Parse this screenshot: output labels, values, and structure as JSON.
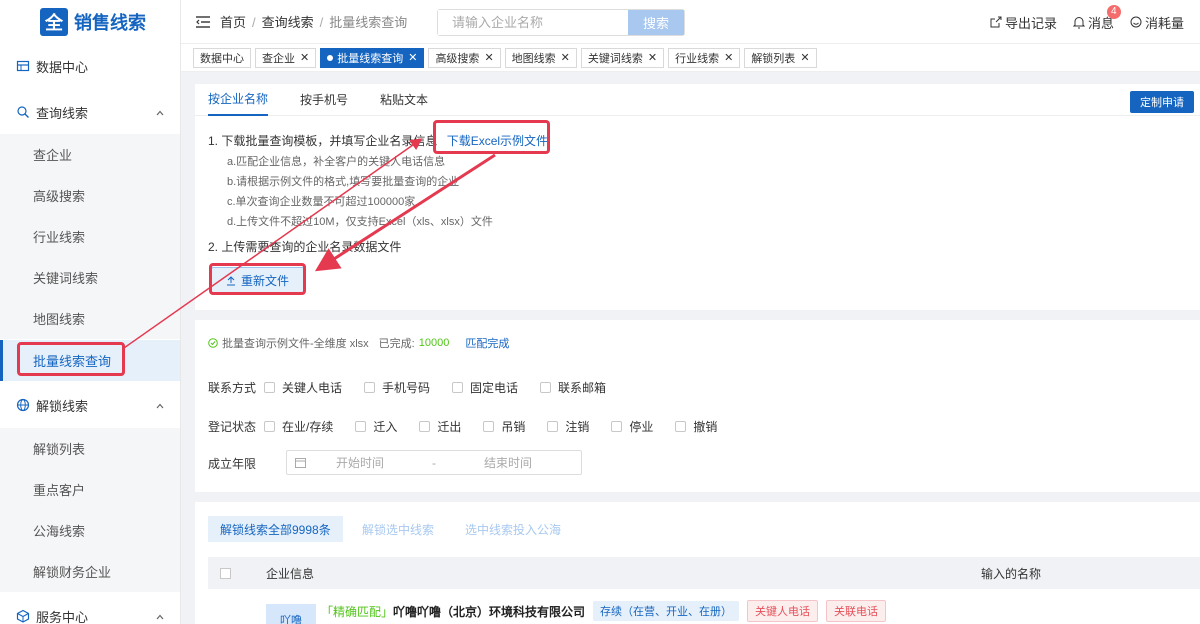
{
  "app": {
    "logo_char": "全",
    "name": "销售线索"
  },
  "sidebar": {
    "data_center": "数据中心",
    "query": "查询线索",
    "query_items": [
      "查企业",
      "高级搜索",
      "行业线索",
      "关键词线索",
      "地图线索",
      "批量线索查询"
    ],
    "unlock": "解锁线索",
    "unlock_items": [
      "解锁列表",
      "重点客户",
      "公海线索",
      "解锁财务企业"
    ],
    "service": "服务中心"
  },
  "header": {
    "breadcrumb": [
      "首页",
      "查询线索",
      "批量线索查询"
    ],
    "search_placeholder": "请输入企业名称",
    "search_button": "搜索",
    "export": "导出记录",
    "messages": "消息",
    "message_count": "4",
    "consumption": "消耗量"
  },
  "tabs": [
    {
      "label": "数据中心",
      "closable": false,
      "active": false
    },
    {
      "label": "查企业",
      "closable": true,
      "active": false
    },
    {
      "label": "批量线索查询",
      "closable": true,
      "active": true
    },
    {
      "label": "高级搜索",
      "closable": true,
      "active": false
    },
    {
      "label": "地图线索",
      "closable": true,
      "active": false
    },
    {
      "label": "关键词线索",
      "closable": true,
      "active": false
    },
    {
      "label": "行业线索",
      "closable": true,
      "active": false
    },
    {
      "label": "解锁列表",
      "closable": true,
      "active": false
    }
  ],
  "panel": {
    "tabs": [
      "按企业名称",
      "按手机号",
      "粘贴文本"
    ],
    "custom_button": "定制申请",
    "step1": "1. 下载批量查询模板，并填写企业名录信息",
    "download_link": "下载Excel示例文件",
    "notes": [
      "a.匹配企业信息，补全客户的关键人电话信息",
      "b.请根据示例文件的格式,填写要批量查询的企业",
      "c.单次查询企业数量不可超过100000家",
      "d.上传文件不超过10M，仅支持Excel（xls、xlsx）文件"
    ],
    "step2": "2. 上传需要查询的企业名录数据文件",
    "upload_button": "重新文件"
  },
  "result": {
    "file_name": "批量查询示例文件-全维度 xlsx",
    "done_label": "已完成:",
    "done_count": "10000",
    "match_status": "匹配完成",
    "contact_label": "联系方式",
    "contact_options": [
      "关键人电话",
      "手机号码",
      "固定电话",
      "联系邮箱"
    ],
    "status_label": "登记状态",
    "status_options": [
      "在业/存续",
      "迁入",
      "迁出",
      "吊销",
      "注销",
      "停业",
      "撤销"
    ],
    "year_label": "成立年限",
    "start_placeholder": "开始时间",
    "range_sep": "-",
    "end_placeholder": "结束时间"
  },
  "list": {
    "unlock_all": "解锁线索全部9998条",
    "unlock_selected": "解锁选中线索",
    "to_pool": "选中线索投入公海",
    "col_company": "企业信息",
    "col_input": "输入的名称",
    "row": {
      "avatar": "吖噜",
      "match": "「精确匹配」",
      "name": "吖噜吖噜（北京）环境科技有限公司",
      "status": "存续（在营、开业、在册）",
      "tag1": "关键人电话",
      "tag2": "关联电话"
    }
  },
  "colors": {
    "primary": "#1565c0",
    "highlight": "#e53950",
    "success": "#52c41a"
  }
}
